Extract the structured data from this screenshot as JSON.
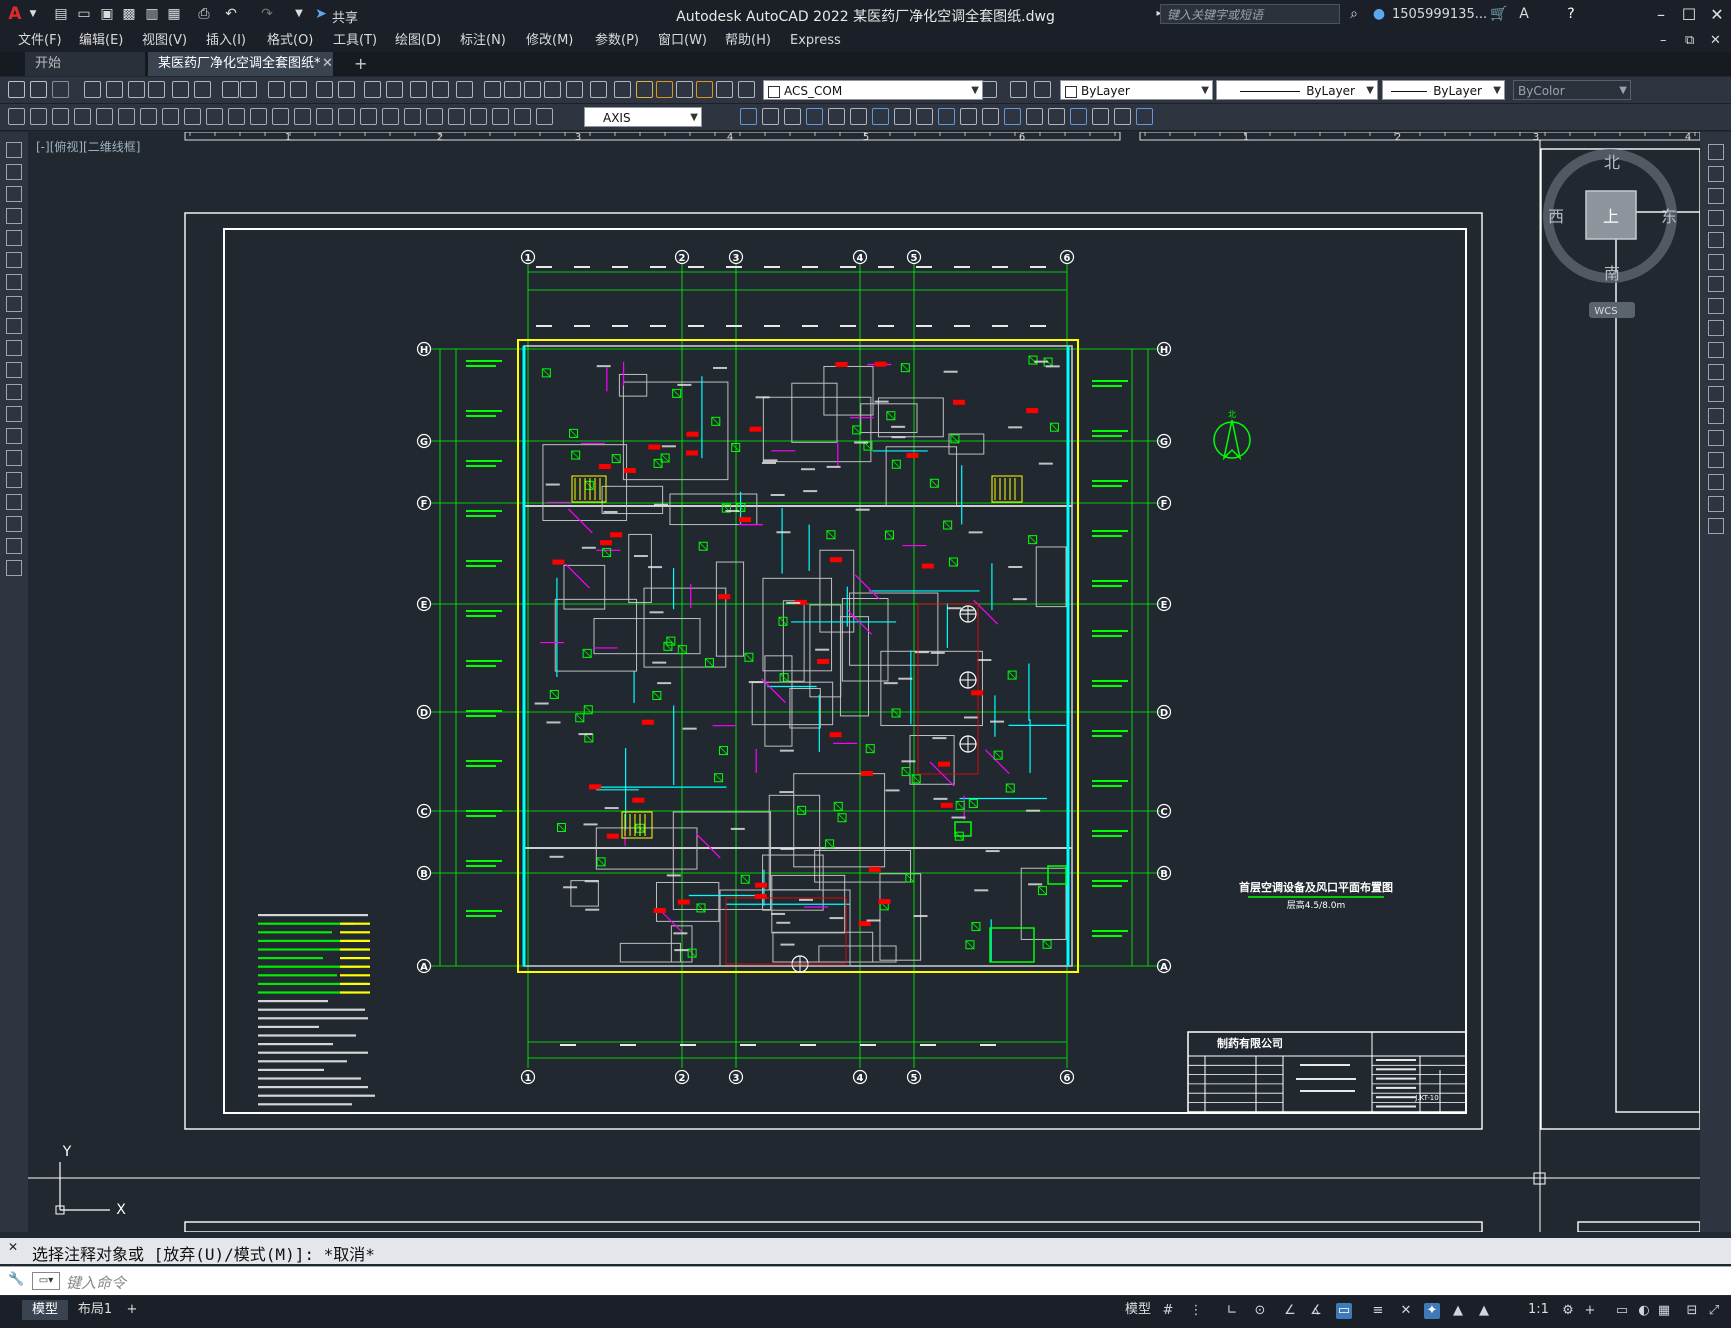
{
  "titlebar": {
    "app_logo": "A",
    "title": "Autodesk AutoCAD 2022    某医药厂净化空调全套图纸.dwg",
    "share_label": "共享",
    "search_placeholder": "键入关键字或短语",
    "user": "1505999135...",
    "minimize_icon": "minimize-icon",
    "maximize_icon": "maximize-icon",
    "close_icon": "close-icon"
  },
  "menubar": {
    "items": [
      "文件(F)",
      "编辑(E)",
      "视图(V)",
      "插入(I)",
      "格式(O)",
      "工具(T)",
      "绘图(D)",
      "标注(N)",
      "修改(M)",
      "参数(P)",
      "窗口(W)",
      "帮助(H)",
      "Express"
    ]
  },
  "tabs": {
    "start": "开始",
    "active": "某医药厂净化空调全套图纸*",
    "close": "✕",
    "add": "+"
  },
  "toolbars": {
    "layer_value": "ACS_COM",
    "color_value": "ByLayer",
    "linetype_value": "ByLayer",
    "lineweight_value": "ByLayer",
    "plotstyle_value": "ByColor",
    "dimstyle_value": "AXIS"
  },
  "viewport": {
    "view_label": "[-][俯视][二维线框]",
    "viewcube": {
      "north": "北",
      "south": "南",
      "east": "东",
      "west": "西",
      "top": "上",
      "wcs": "WCS"
    },
    "ucs": {
      "x": "X",
      "y": "Y"
    },
    "ruler_top": [
      "1",
      "2",
      "3",
      "4",
      "5",
      "6",
      "1",
      "2",
      "3",
      "4"
    ]
  },
  "drawing": {
    "grid_cols": [
      "1",
      "2",
      "3",
      "4",
      "5",
      "6"
    ],
    "grid_rows": [
      "H",
      "G",
      "F",
      "E",
      "D",
      "C",
      "B",
      "A"
    ],
    "title_text": "首层空调设备及风口平面布置图",
    "scale_text": "层高4.5/8.0m",
    "company": "制药有限公司",
    "titleblock_code": "J.KT-10",
    "north_label": "北"
  },
  "command": {
    "history": "选择注释对象或 [放弃(U)/模式(M)]: *取消*",
    "placeholder": "键入命令"
  },
  "statusbar": {
    "model_tab": "模型",
    "layout_tab": "布局1",
    "add_tab": "+",
    "model_label": "模型",
    "scale": "1:1"
  },
  "colors": {
    "bg": "#212830",
    "green": "#00ff00",
    "cyan": "#00ffff",
    "magenta": "#ff00ff",
    "red": "#ff0000",
    "yellow": "#ffff00",
    "white": "#ffffff"
  }
}
